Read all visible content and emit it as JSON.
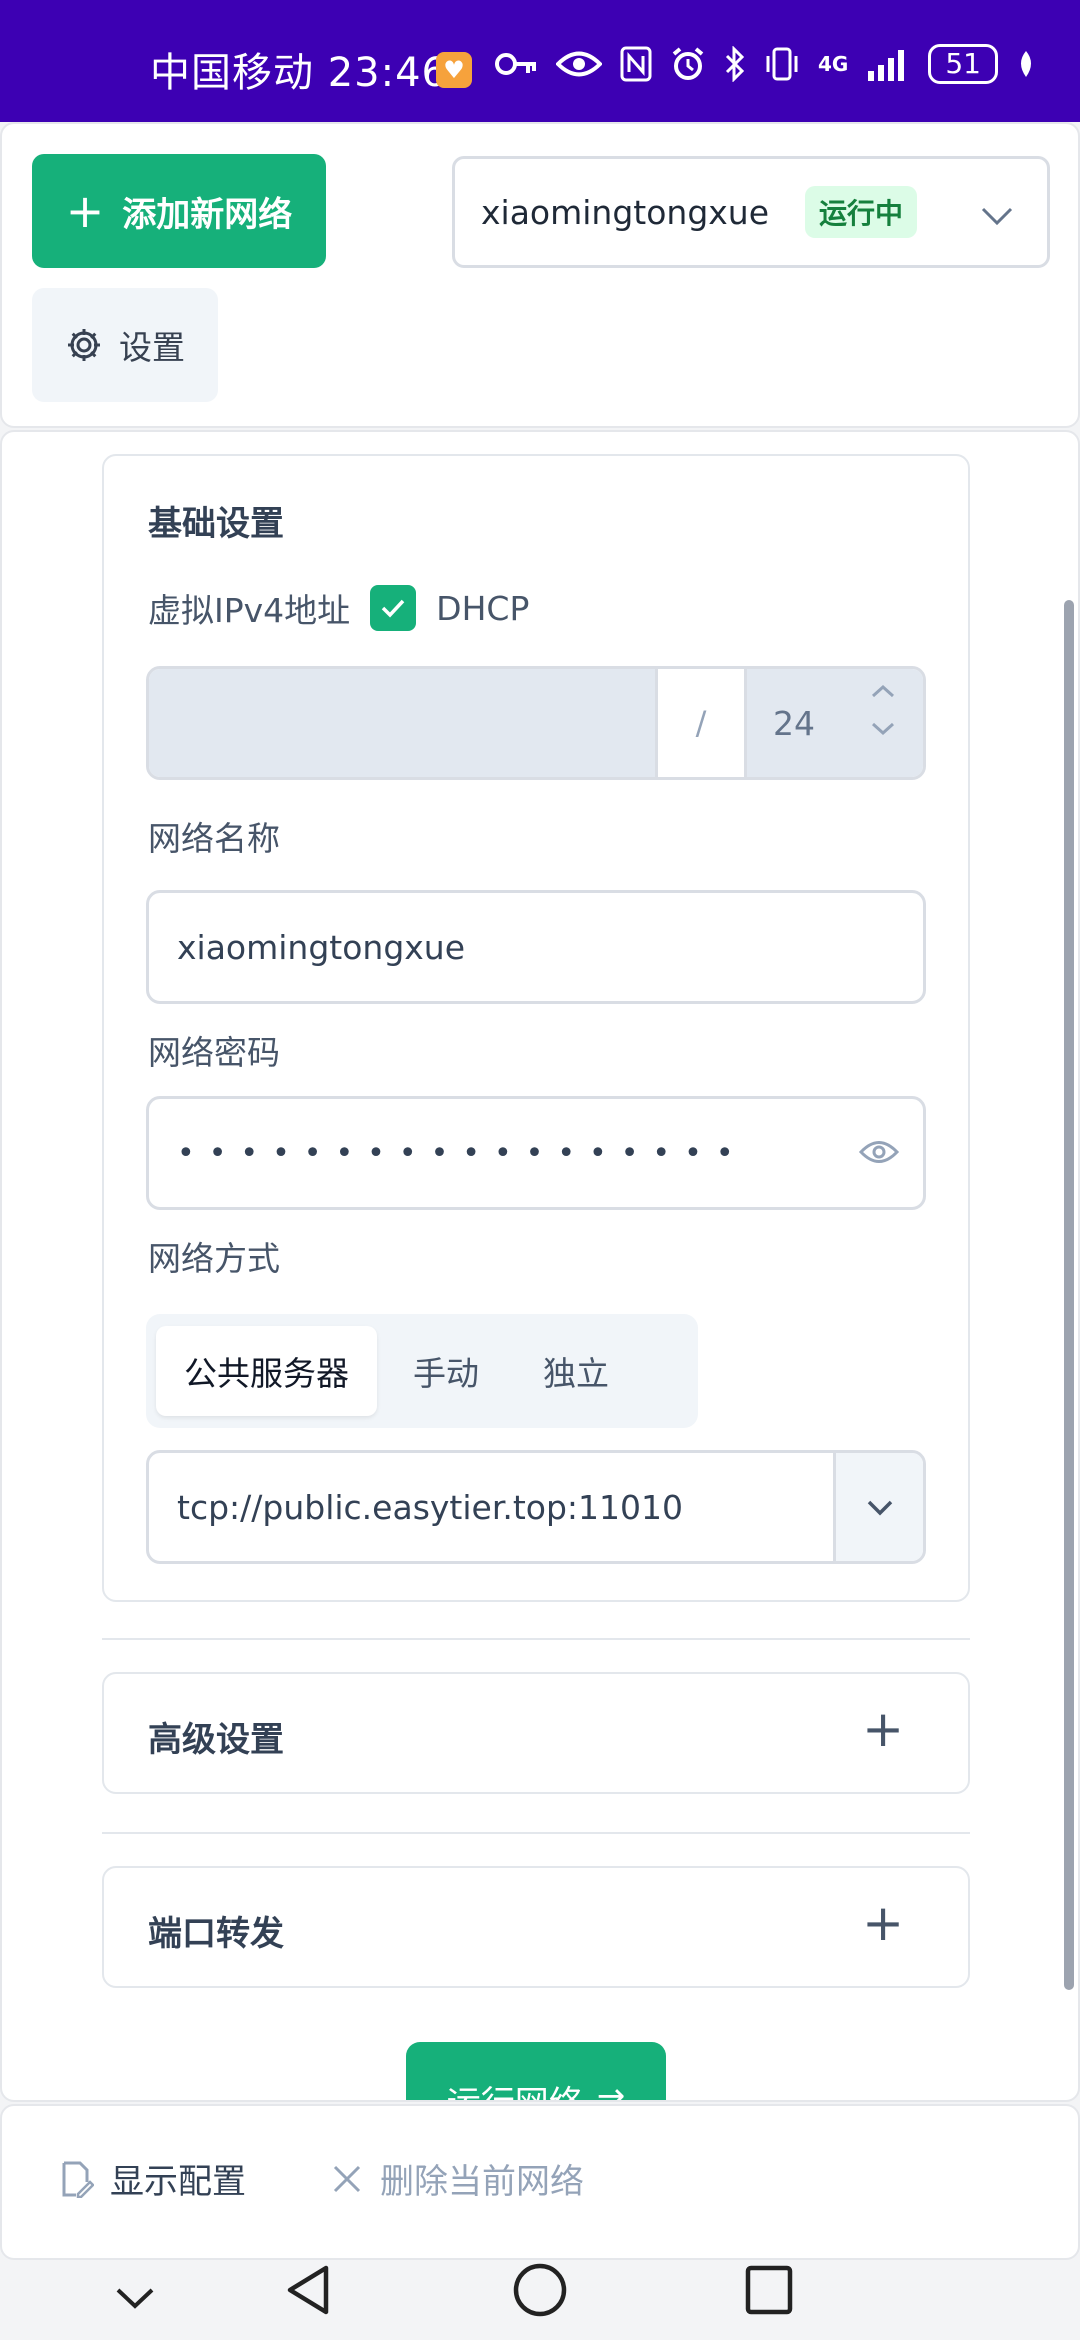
{
  "status_bar": {
    "carrier_time": "中国移动 23:46",
    "network_type": "4G",
    "battery": "51"
  },
  "header": {
    "add_network_label": "添加新网络",
    "selected_network": "xiaomingtongxue",
    "network_status": "运行中",
    "settings_label": "设置"
  },
  "basic_settings": {
    "title": "基础设置",
    "ipv4_label": "虚拟IPv4地址",
    "dhcp_label": "DHCP",
    "dhcp_checked": true,
    "ip_value": "",
    "slash": "/",
    "mask_value": "24",
    "network_name_label": "网络名称",
    "network_name_value": "xiaomingtongxue",
    "network_password_label": "网络密码",
    "network_password_mask": "••••••••••••••••••",
    "network_mode_label": "网络方式",
    "modes": [
      "公共服务器",
      "手动",
      "独立"
    ],
    "active_mode": "公共服务器",
    "server_value": "tcp://public.easytier.top:11010"
  },
  "sections": {
    "advanced_title": "高级设置",
    "port_forward_title": "端口转发"
  },
  "run_button_label": "运行网络",
  "bottom_bar": {
    "show_config_label": "显示配置",
    "delete_network_label": "删除当前网络"
  },
  "colors": {
    "status_bar": "#3d00b3",
    "accent": "#16b07a",
    "tag_bg": "#dcfce7",
    "tag_text": "#15803d"
  }
}
